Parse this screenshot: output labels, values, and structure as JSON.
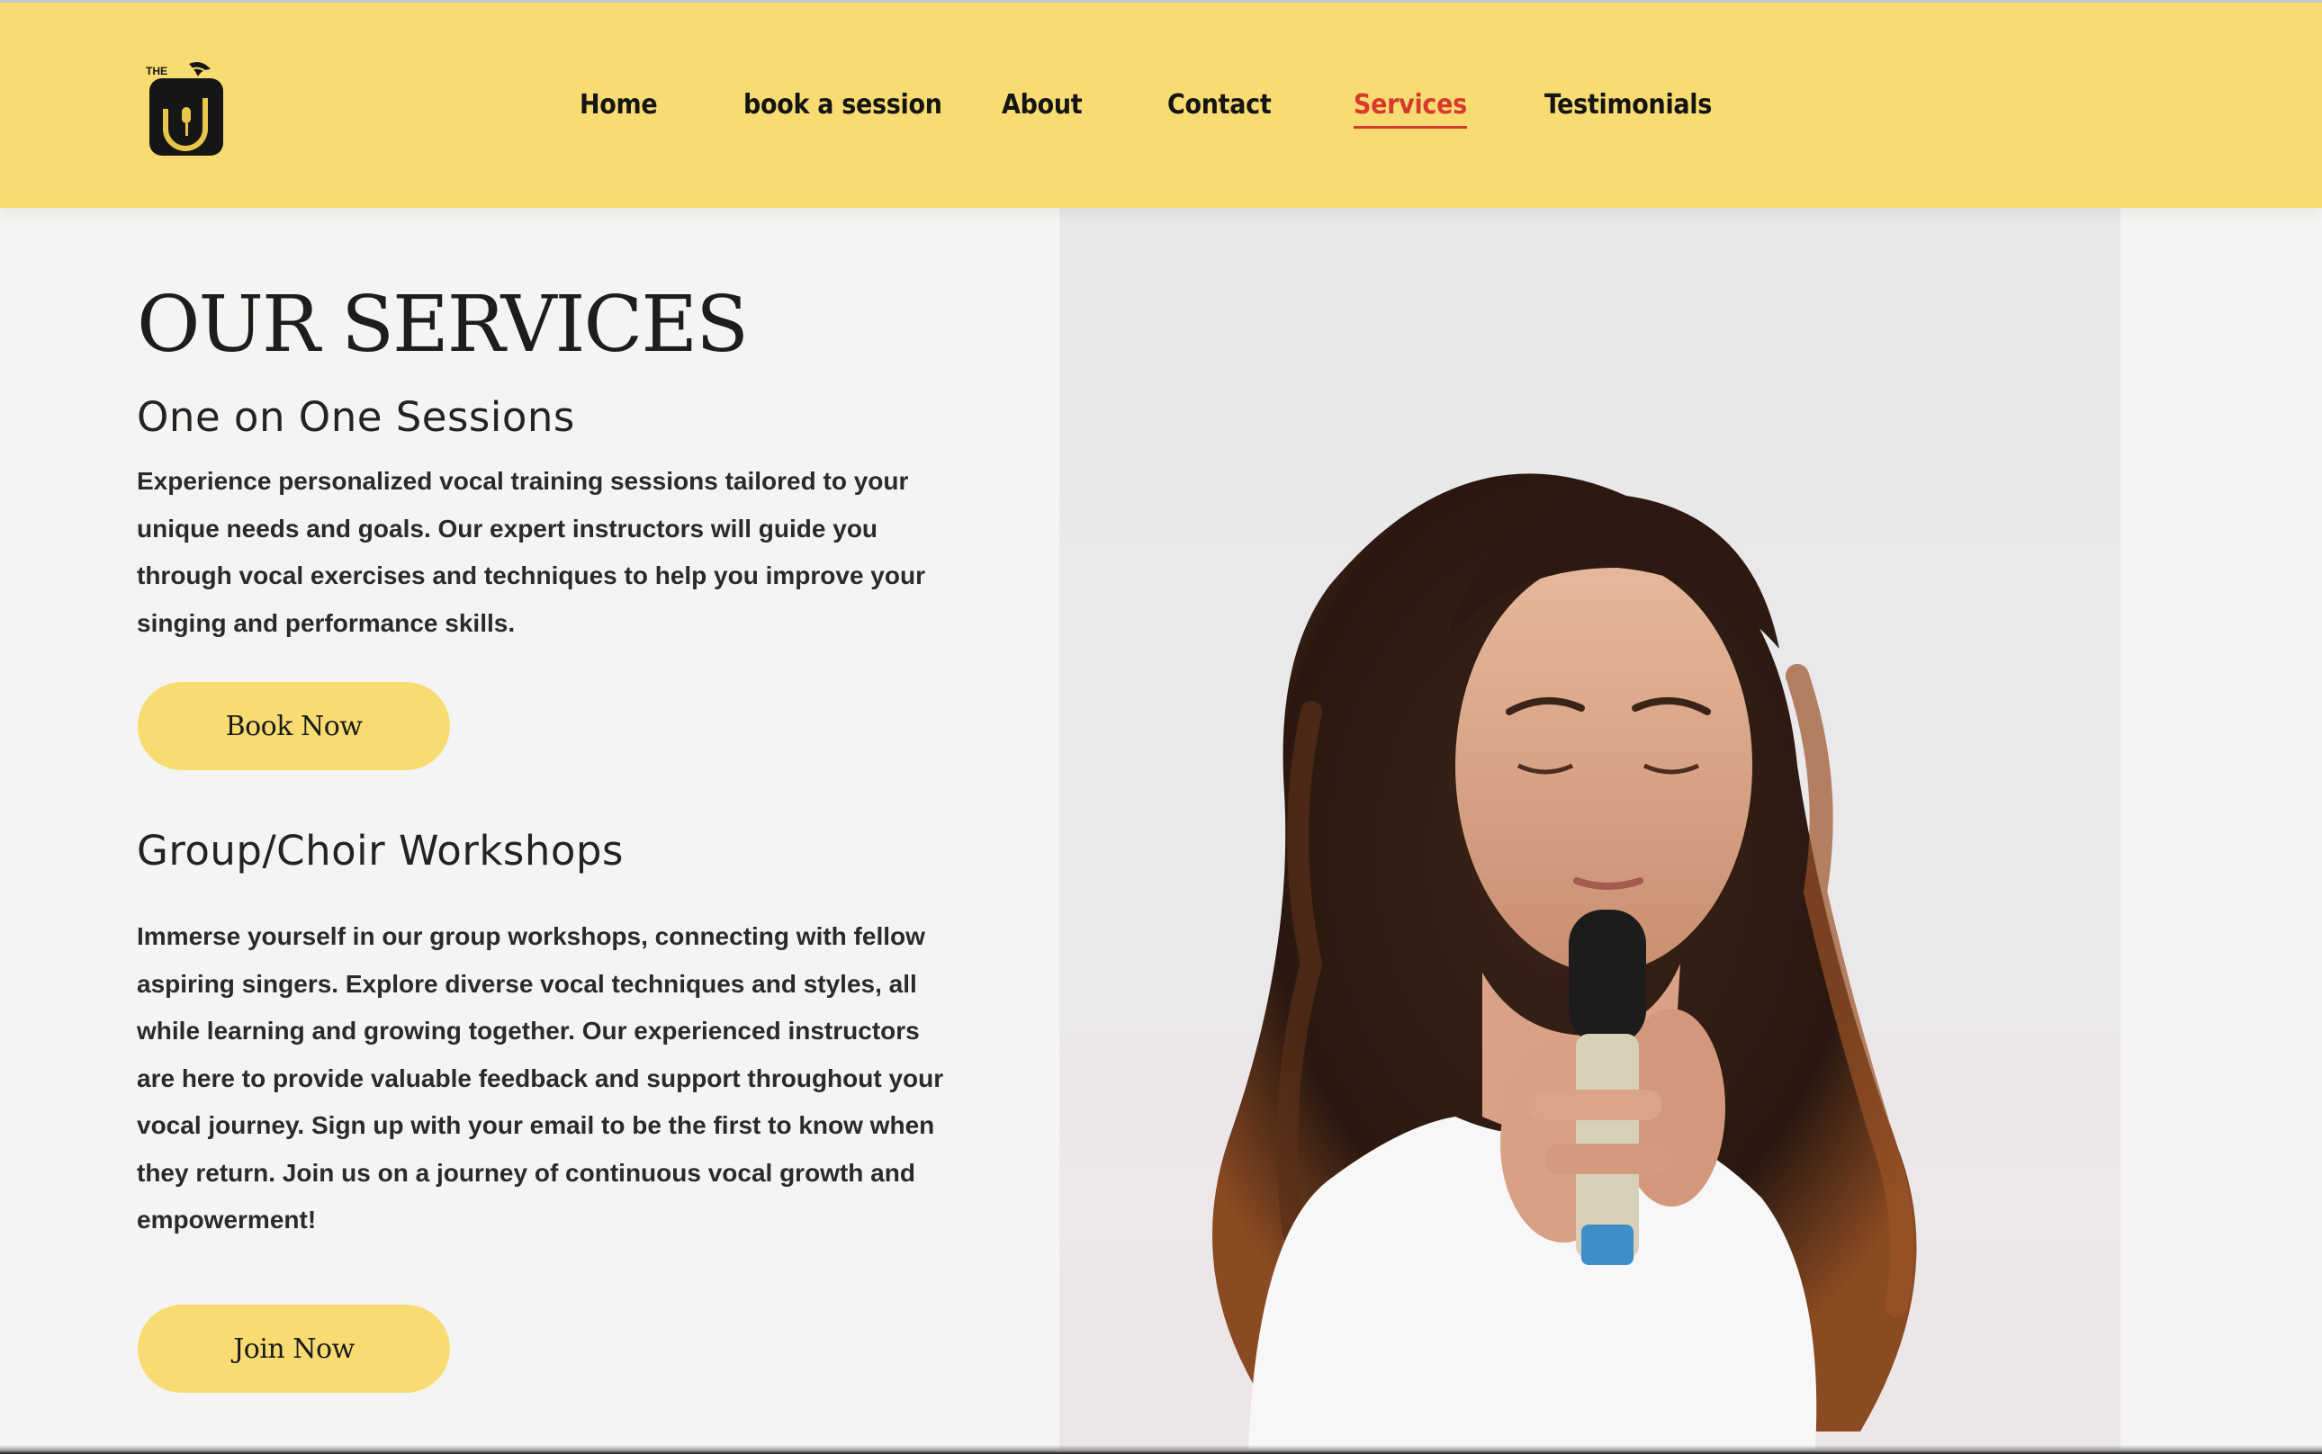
{
  "header": {
    "logo_text": "THE",
    "nav": [
      {
        "label": "Home"
      },
      {
        "label": "book a session"
      },
      {
        "label": "About"
      },
      {
        "label": "Contact"
      },
      {
        "label": "Services",
        "active": true
      },
      {
        "label": "Testimonials"
      }
    ]
  },
  "main": {
    "title": "OUR SERVICES",
    "sections": [
      {
        "heading": "One on One Sessions",
        "body": "Experience personalized vocal training sessions tailored to your unique needs and goals. Our expert instructors will guide you through vocal exercises and techniques to help you improve your singing and performance skills.",
        "button": "Book Now"
      },
      {
        "heading": "Group/Choir Workshops",
        "body": "Immerse yourself in our group workshops, connecting with fellow aspiring singers. Explore diverse vocal techniques and styles, all while learning and growing together. Our experienced instructors are here to provide valuable feedback and support throughout your vocal journey. Sign up with your email to be the first to know when they return. Join us on a journey of continuous vocal growth and empowerment!",
        "button": "Join Now"
      }
    ]
  },
  "colors": {
    "header_bg": "#f8dc72",
    "active_nav": "#d63a2f",
    "page_bg": "#f4f5f2",
    "button_bg": "#f8dc72"
  },
  "icons": [
    "logo-icon"
  ]
}
